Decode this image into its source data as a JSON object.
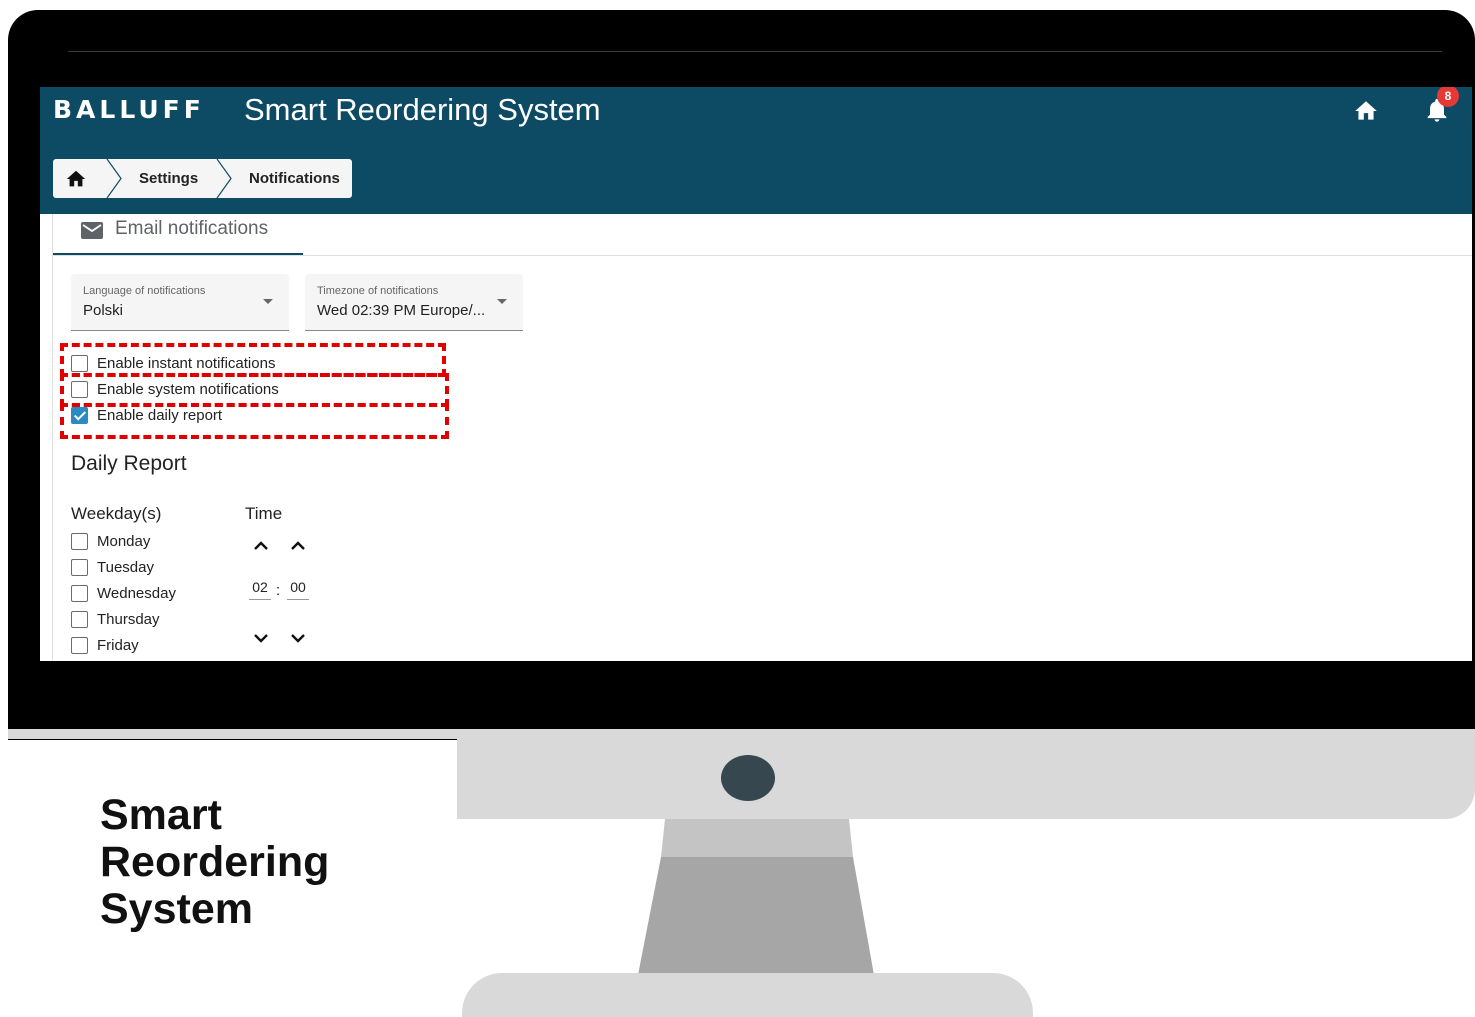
{
  "app": {
    "logo": "BALLUFF",
    "title": "Smart Reordering System",
    "notification_count": "8"
  },
  "breadcrumb": [
    "Settings",
    "Notifications"
  ],
  "tab": {
    "label": "Email notifications",
    "icon": "mail-icon"
  },
  "language_select": {
    "label": "Language of notifications",
    "value": "Polski"
  },
  "timezone_select": {
    "label": "Timezone of notifications",
    "value": "Wed 02:39 PM Europe/..."
  },
  "options": [
    {
      "label": "Enable instant notifications",
      "checked": false
    },
    {
      "label": "Enable system notifications",
      "checked": false
    },
    {
      "label": "Enable daily report",
      "checked": true
    }
  ],
  "daily_report": {
    "title": "Daily Report",
    "weekdays_header": "Weekday(s)",
    "time_header": "Time",
    "weekdays": [
      "Monday",
      "Tuesday",
      "Wednesday",
      "Thursday",
      "Friday"
    ],
    "hour": "02",
    "minute": "00"
  },
  "brand_caption": [
    "Smart",
    "Reordering",
    "System"
  ],
  "colors": {
    "app_bar": "#0d4a64",
    "highlight": "#e00000",
    "checkbox_checked": "#2b8cc4",
    "badge": "#e53935"
  }
}
